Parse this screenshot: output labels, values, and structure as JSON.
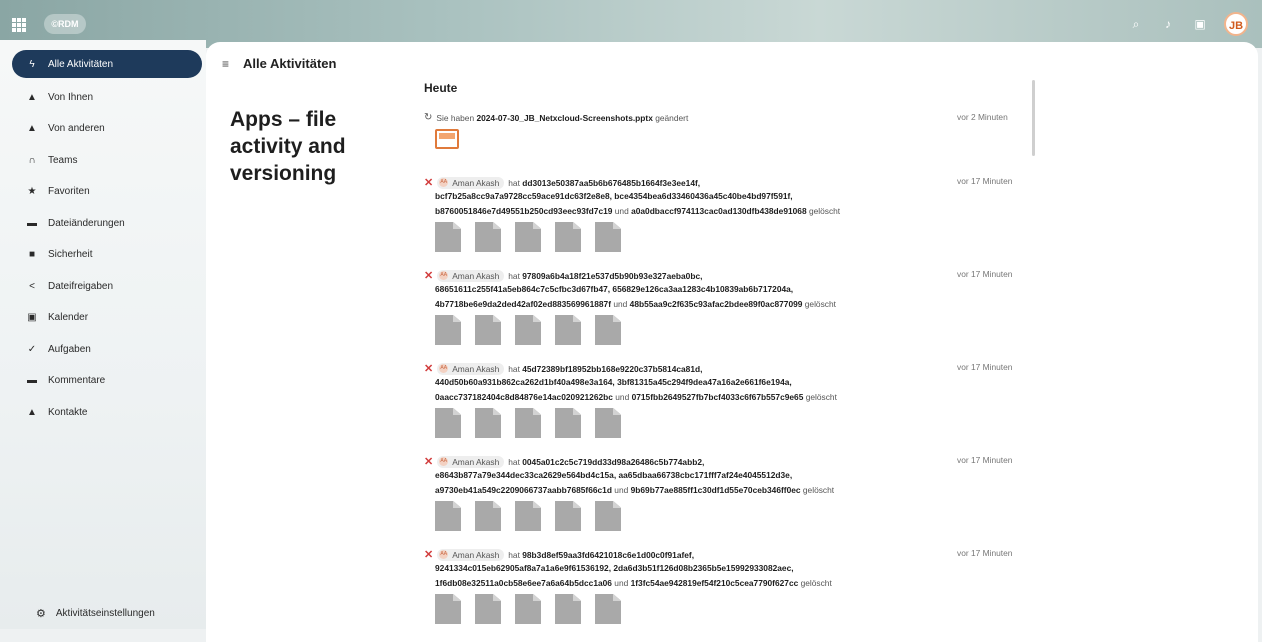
{
  "topbar": {
    "logo_text": "©RDM",
    "avatar_initials": "JB",
    "icons": [
      "apps-grid-icon",
      "search-icon",
      "notifications-icon",
      "contacts-icon"
    ]
  },
  "sidebar": {
    "items": [
      {
        "label": "Alle Aktivitäten",
        "icon": "bolt-icon"
      },
      {
        "label": "Von Ihnen",
        "icon": "user-icon"
      },
      {
        "label": "Von anderen",
        "icon": "users-icon"
      },
      {
        "label": "Teams",
        "icon": "teams-icon"
      },
      {
        "label": "Favoriten",
        "icon": "star-icon"
      },
      {
        "label": "Dateiänderungen",
        "icon": "folder-icon"
      },
      {
        "label": "Sicherheit",
        "icon": "lock-icon"
      },
      {
        "label": "Dateifreigaben",
        "icon": "share-icon"
      },
      {
        "label": "Kalender",
        "icon": "calendar-icon"
      },
      {
        "label": "Aufgaben",
        "icon": "check-icon"
      },
      {
        "label": "Kommentare",
        "icon": "comment-icon"
      },
      {
        "label": "Kontakte",
        "icon": "contacts-icon"
      }
    ],
    "settings_label": "Aktivitätseinstellungen"
  },
  "main": {
    "title": "Alle Aktivitäten",
    "overlay_title": "Apps – file activity and versioning",
    "section_title": "Heute",
    "first_entry": {
      "prefix": "Sie haben",
      "file": "2024-07-30_JB_Netxcloud-Screenshots.pptx",
      "suffix": "geändert",
      "time": "vor 2 Minuten"
    },
    "user_name": "Aman Akash",
    "word_hat": "hat",
    "word_und": "und",
    "word_deleted": "gelöscht",
    "entries": [
      {
        "h1": "dd3013e50387aa5b6b676485b1664f3e3ee14f,",
        "h2": "bcf7b25a8cc9a7a9728cc59ace91dc63f2e8e8,",
        "h3": "bce4354bea6d33460436a45c40be4bd97f591f,",
        "h4": "b8760051846e7d49551b250cd93eec93fd7c19",
        "h5": "a0a0dbaccf974113cac0ad130dfb438de91068",
        "time": "vor 17 Minuten"
      },
      {
        "h1": "97809a6b4a18f21e537d5b90b93e327aeba0bc,",
        "h2": "68651611c255f41a5eb864c7c5cfbc3d67fb47,",
        "h3": "656829e126ca3aa1283c4b10839ab6b717204a,",
        "h4": "4b7718be6e9da2ded42af02ed883569961887f",
        "h5": "48b55aa9c2f635c93afac2bdee89f0ac877099",
        "time": "vor 17 Minuten"
      },
      {
        "h1": "45d72389bf18952bb168e9220c37b5814ca81d,",
        "h2": "440d50b60a931b862ca262d1bf40a498e3a164,",
        "h3": "3bf81315a45c294f9dea47a16a2e661f6e194a,",
        "h4": "0aacc737182404c8d84876e14ac020921262bc",
        "h5": "0715fbb2649527fb7bcf4033c6f67b557c9e65",
        "time": "vor 17 Minuten"
      },
      {
        "h1": "0045a01c2c5c719dd33d98a26486c5b774abb2,",
        "h2": "e8643b877a79e344dec33ca2629e564bd4c15a,",
        "h3": "aa65dbaa66738cbc171fff7af24e4045512d3e,",
        "h4": "a9730eb41a549c2209066737aabb7685f66c1d",
        "h5": "9b69b77ae885ff1c30df1d55e70ceb346ff0ec",
        "time": "vor 17 Minuten"
      },
      {
        "h1": "98b3d8ef59aa3fd6421018c6e1d00c0f91afef,",
        "h2": "9241334c015eb62905af8a7a1a6e9f61536192,",
        "h3": "2da6d3b51f126d08b2365b5e15992933082aec,",
        "h4": "1f6db08e32511a0cb58e6ee7a6a64b5dcc1a06",
        "h5": "1f3fc54ae942819ef54f210c5cea7790f627cc",
        "time": "vor 17 Minuten"
      }
    ]
  },
  "colors": {
    "accent": "#1e3a5b",
    "delete": "#d13c3c",
    "pptx": "#e07a3b"
  }
}
